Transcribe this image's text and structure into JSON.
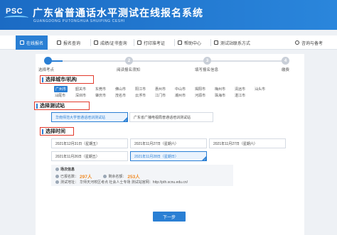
{
  "header": {
    "logo_text": "PSC",
    "title": "广东省普通话水平测试在线报名系统",
    "subtitle": "GUANGDONG PUTONGHUA SHUIPING CESHI"
  },
  "nav": {
    "items": [
      {
        "label": "在线报名",
        "icon": "pencil-icon",
        "active": true
      },
      {
        "label": "报名查询",
        "icon": "search-icon",
        "active": false
      },
      {
        "label": "成绩/证书查询",
        "icon": "certificate-icon",
        "active": false
      },
      {
        "label": "打印准考证",
        "icon": "printer-icon",
        "active": false
      },
      {
        "label": "帮助中心",
        "icon": "help-icon",
        "active": false
      },
      {
        "label": "测试站联系方式",
        "icon": "contact-icon",
        "active": false
      },
      {
        "label": "咨询与备考",
        "icon": "chat-icon",
        "active": false
      }
    ]
  },
  "steps": [
    {
      "num": "",
      "label": "选择考点",
      "done": true
    },
    {
      "num": "2",
      "label": "阅读报名须知",
      "done": false
    },
    {
      "num": "3",
      "label": "填写报名信息",
      "done": false
    },
    {
      "num": "4",
      "label": "缴费",
      "done": false
    }
  ],
  "sections": {
    "city": "选择城市/机构",
    "site": "选择测试站",
    "time": "选择时间"
  },
  "cities": {
    "row1": [
      "广州市",
      "韶关市",
      "东莞市",
      "佛山市",
      "阳江市",
      "惠州市",
      "中山市",
      "揭阳市",
      "梅州市",
      "清远市",
      "汕头市"
    ],
    "row2": [
      "汕尾市",
      "深圳市",
      "肇庆市",
      "茂名市",
      "云浮市",
      "江门市",
      "潮州市",
      "河源市",
      "珠海市",
      "湛江市"
    ],
    "active": "广州市"
  },
  "sites": [
    {
      "label": "华南师范大学普通话培训测试站",
      "active": true
    },
    {
      "label": "广东省广播电视局普通话培训测试站",
      "active": false
    }
  ],
  "slots": [
    {
      "label": "2021年12月31日（星期五）",
      "active": false
    },
    {
      "label": "2021年11月27日（星期六）",
      "active": false
    },
    {
      "label": "2021年11月27日（星期六）",
      "active": false
    },
    {
      "label": "2021年11月26日（星期五）",
      "active": false
    },
    {
      "label": "2021年11月28日（星期日）",
      "active": true
    }
  ],
  "info": {
    "title": "场次信息",
    "registered_label": "已报名数：",
    "registered_value": "297人",
    "remaining_label": "剩余名额：",
    "remaining_value": "253人",
    "address_label": "测试地址：",
    "address_value": "华师天河校区考点 社会人士专场 测试站官网：http://pth.scnu.edu.cn/"
  },
  "next_label": "下一步",
  "colors": {
    "primary": "#2a7fd4",
    "highlight": "#e23a2c",
    "accent": "#f08a24"
  }
}
